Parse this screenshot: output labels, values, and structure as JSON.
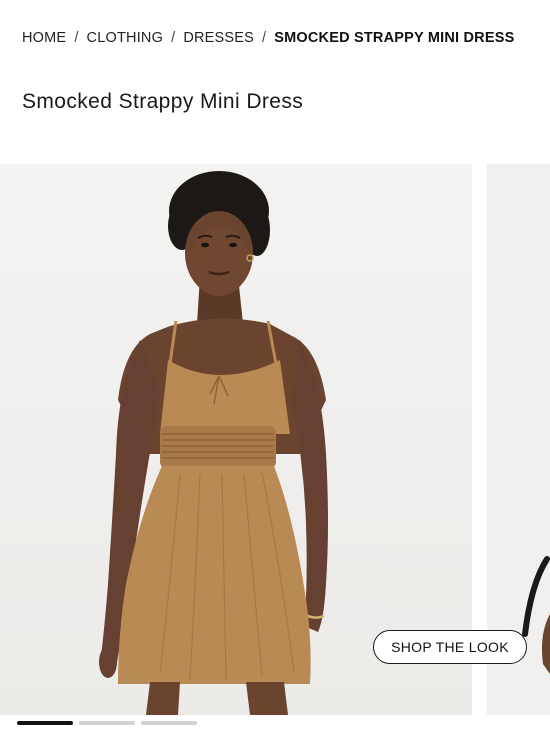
{
  "breadcrumb": {
    "items": [
      {
        "label": "HOME",
        "name": "breadcrumb-home"
      },
      {
        "label": "CLOTHING",
        "name": "breadcrumb-clothing"
      },
      {
        "label": "DRESSES",
        "name": "breadcrumb-dresses"
      }
    ],
    "separator": "/",
    "current": "SMOCKED STRAPPY MINI DRESS"
  },
  "product": {
    "title": "Smocked Strappy Mini Dress"
  },
  "gallery": {
    "main_image": "model-wearing-dress-photo",
    "next_image": "partial-next-photo",
    "shop_the_look_label": "SHOP THE LOOK",
    "slide_count": 3,
    "active_slide": 1
  },
  "colors": {
    "text": "#1a1a1a",
    "background": "#ffffff",
    "photo_background": "#f0efed",
    "dress": "#b98a53",
    "indicator_active": "#111111",
    "indicator_inactive": "#d3d3d3"
  }
}
